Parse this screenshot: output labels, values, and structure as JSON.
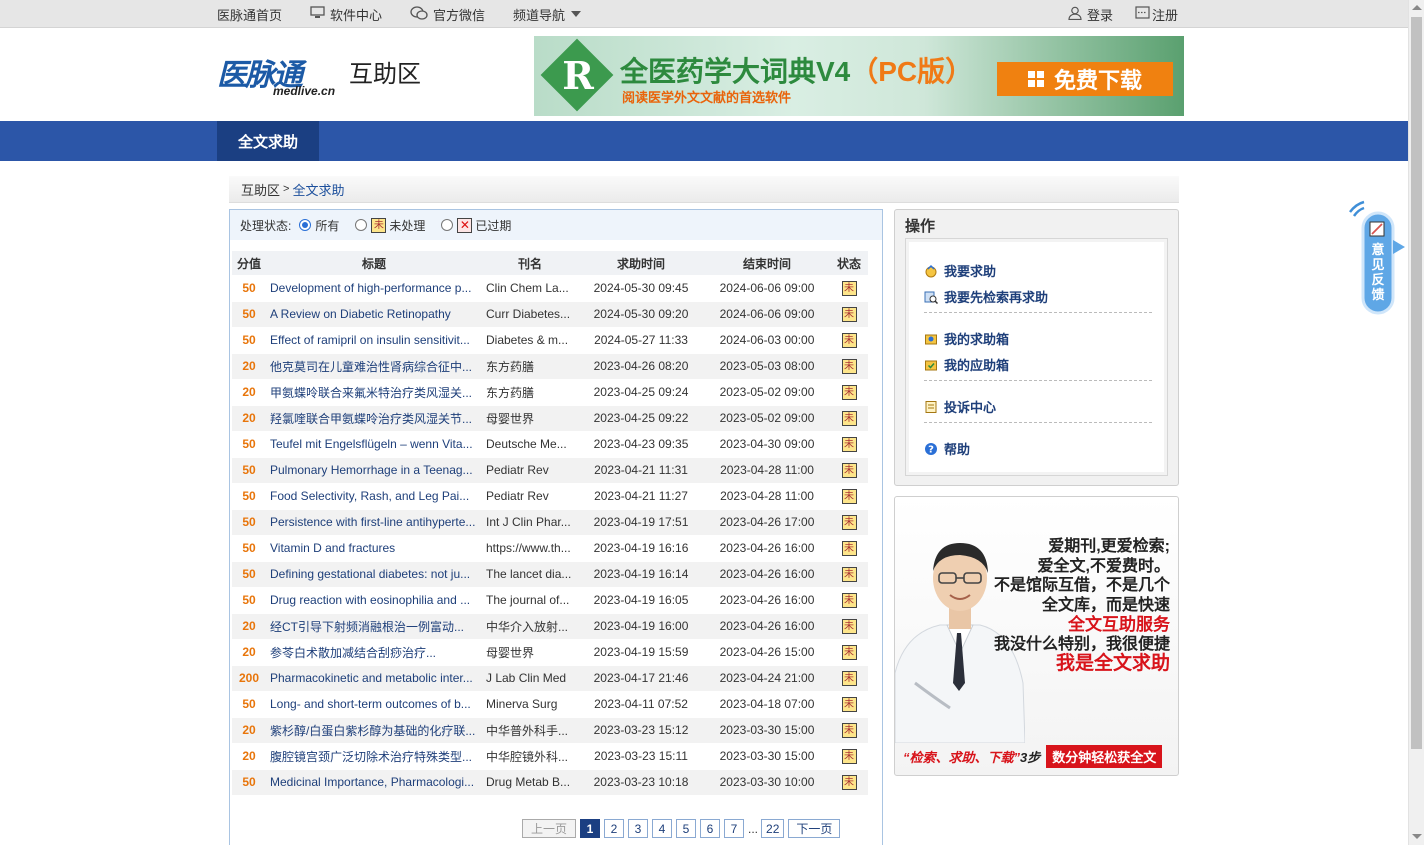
{
  "topbar": {
    "home": "医脉通首页",
    "software": "软件中心",
    "wechat": "官方微信",
    "channel_nav": "频道导航",
    "login": "登录",
    "register": "注册"
  },
  "header": {
    "logo_cn": "医脉通",
    "logo_en": "medlive.cn",
    "section_title": "互助区"
  },
  "banner": {
    "title_main": "全医药学大词典V4",
    "title_pc": "（PC版）",
    "subtitle": "阅读医学外文文献的首选软件",
    "download": "免费下载"
  },
  "nav": {
    "active_tab": "全文求助"
  },
  "breadcrumb": {
    "root": "互助区",
    "sep": ">",
    "current": "全文求助"
  },
  "filter": {
    "label": "处理状态:",
    "all": "所有",
    "unprocessed": "未处理",
    "expired": "已过期",
    "badge_un": "未",
    "badge_ex": "✕"
  },
  "table": {
    "headers": [
      "分值",
      "标题",
      "刊名",
      "求助时间",
      "结束时间",
      "状态"
    ],
    "status_badge": "未",
    "rows": [
      {
        "score": "50",
        "title": "Development of high-performance p...",
        "journal": "Clin Chem La...",
        "req": "2024-05-30 09:45",
        "end": "2024-06-06 09:00"
      },
      {
        "score": "50",
        "title": "A Review on Diabetic Retinopathy",
        "journal": "Curr Diabetes...",
        "req": "2024-05-30 09:20",
        "end": "2024-06-06 09:00"
      },
      {
        "score": "50",
        "title": "Effect of ramipril on insulin sensitivit...",
        "journal": "Diabetes & m...",
        "req": "2024-05-27 11:33",
        "end": "2024-06-03 00:00"
      },
      {
        "score": "20",
        "title": "他克莫司在儿童难治性肾病综合征中...",
        "journal": "东方药膳",
        "req": "2023-04-26 08:20",
        "end": "2023-05-03 08:00"
      },
      {
        "score": "20",
        "title": "甲氨蝶呤联合来氟米特治疗类风湿关...",
        "journal": "东方药膳",
        "req": "2023-04-25 09:24",
        "end": "2023-05-02 09:00"
      },
      {
        "score": "20",
        "title": "羟氯喹联合甲氨蝶呤治疗类风湿关节...",
        "journal": "母婴世界",
        "req": "2023-04-25 09:22",
        "end": "2023-05-02 09:00"
      },
      {
        "score": "50",
        "title": "Teufel mit Engelsflügeln – wenn Vita...",
        "journal": "Deutsche Me...",
        "req": "2023-04-23 09:35",
        "end": "2023-04-30 09:00"
      },
      {
        "score": "50",
        "title": "Pulmonary Hemorrhage in a Teenag...",
        "journal": "Pediatr Rev",
        "req": "2023-04-21 11:31",
        "end": "2023-04-28 11:00"
      },
      {
        "score": "50",
        "title": "Food Selectivity, Rash, and Leg Pai...",
        "journal": "Pediatr Rev",
        "req": "2023-04-21 11:27",
        "end": "2023-04-28 11:00"
      },
      {
        "score": "50",
        "title": "Persistence with first-line antihyperte...",
        "journal": "Int J Clin Phar...",
        "req": "2023-04-19 17:51",
        "end": "2023-04-26 17:00"
      },
      {
        "score": "50",
        "title": "Vitamin D and fractures",
        "journal": "https://www.th...",
        "req": "2023-04-19 16:16",
        "end": "2023-04-26 16:00"
      },
      {
        "score": "50",
        "title": "Defining gestational diabetes: not ju...",
        "journal": "The lancet dia...",
        "req": "2023-04-19 16:14",
        "end": "2023-04-26 16:00"
      },
      {
        "score": "50",
        "title": "Drug reaction with eosinophilia and ...",
        "journal": "The journal of...",
        "req": "2023-04-19 16:05",
        "end": "2023-04-26 16:00"
      },
      {
        "score": "20",
        "title": "经CT引导下射频消融根治一例富动...",
        "journal": "中华介入放射...",
        "req": "2023-04-19 16:00",
        "end": "2023-04-26 16:00"
      },
      {
        "score": "20",
        "title": "参苓白术散加减结合刮痧治疗...",
        "journal": "母婴世界",
        "req": "2023-04-19 15:59",
        "end": "2023-04-26 15:00"
      },
      {
        "score": "200",
        "title": "Pharmacokinetic and metabolic inter...",
        "journal": "J Lab Clin Med",
        "req": "2023-04-17 21:46",
        "end": "2023-04-24 21:00"
      },
      {
        "score": "50",
        "title": "Long- and short-term outcomes of b...",
        "journal": "Minerva Surg",
        "req": "2023-04-11 07:52",
        "end": "2023-04-18 07:00"
      },
      {
        "score": "20",
        "title": "紫杉醇/白蛋白紫杉醇为基础的化疗联...",
        "journal": "中华普外科手...",
        "req": "2023-03-23 15:12",
        "end": "2023-03-30 15:00"
      },
      {
        "score": "20",
        "title": "腹腔镜宫颈广泛切除术治疗特殊类型...",
        "journal": "中华腔镜外科...",
        "req": "2023-03-23 15:11",
        "end": "2023-03-30 15:00"
      },
      {
        "score": "50",
        "title": "Medicinal Importance, Pharmacologi...",
        "journal": "Drug Metab B...",
        "req": "2023-03-23 10:18",
        "end": "2023-03-30 10:00"
      }
    ]
  },
  "pager": {
    "prev": "上一页",
    "pages": [
      "1",
      "2",
      "3",
      "4",
      "5",
      "6",
      "7"
    ],
    "dots": "...",
    "last": "22",
    "next": "下一页",
    "current": "1"
  },
  "ops": {
    "title": "操作",
    "items": [
      "我要求助",
      "我要先检索再求助",
      "我的求助箱",
      "我的应助箱",
      "投诉中心",
      "帮助"
    ]
  },
  "ad": {
    "line1": "爱期刊,更爱检索;",
    "line2": "爱全文,不爱费时。",
    "line3": "不是馆际互借，不是几个",
    "line4": "全文库，而是快速",
    "line5": "全文互助服务",
    "line6": "我没什么特别，我很便捷",
    "line7": "我是全文求助",
    "foot_quote": "“检索、求助、下载”",
    "foot_steps": "3步",
    "foot_box": "数分钟轻松获全文"
  },
  "feedback": {
    "label": "意见反馈"
  },
  "colors": {
    "nav": "#2c56a8",
    "nav_active": "#1b3f82",
    "score": "#e8750a",
    "link": "#1e3f7a",
    "accent_red": "#d8141b"
  }
}
